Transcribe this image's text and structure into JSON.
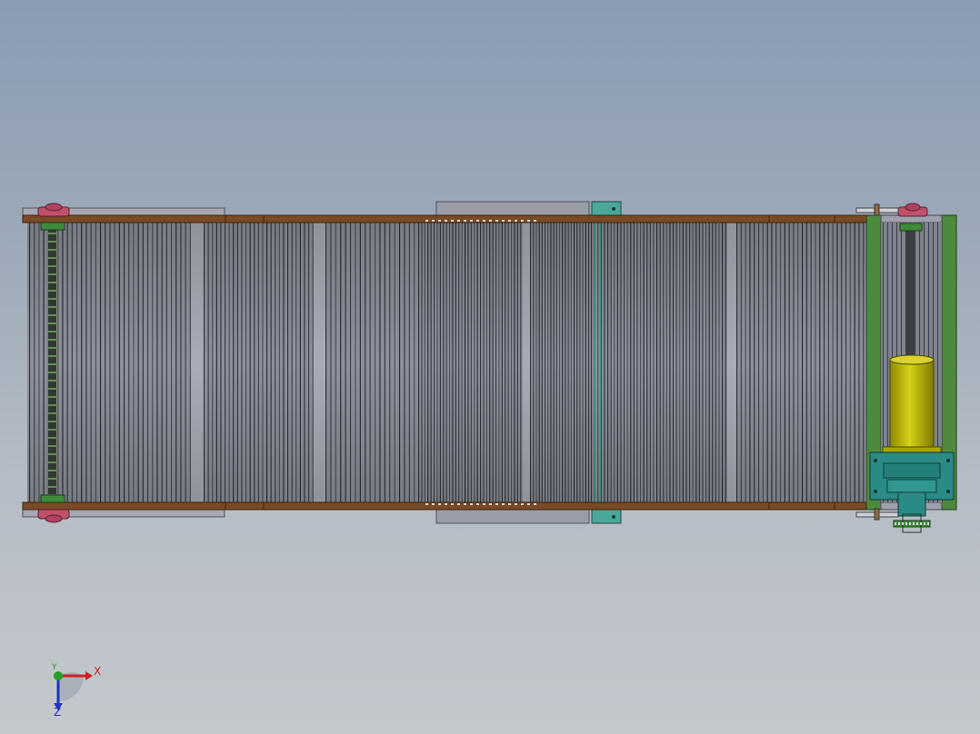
{
  "viewport": {
    "background_top": "#8a9cb2",
    "background_bottom": "#c4c8cd"
  },
  "model": {
    "colors": {
      "frame_rail": "#7a4a26",
      "belt_slat_light": "#9a9ea8",
      "belt_slat_dark": "#3a3c44",
      "roller_bearing": "#c0506a",
      "motor_body": "#b8b000",
      "gear_housing": "#2a8a86",
      "drive_frame": "#4e8a3e",
      "side_guide": "#9ea0ab",
      "bracket": "#4aa89a",
      "chain_guide": "#3e7a3a"
    }
  },
  "triad": {
    "x_label": "X",
    "y_label": "Y",
    "z_label": "Z",
    "x_color": "#d02020",
    "y_color": "#20a020",
    "z_color": "#2030c0"
  }
}
